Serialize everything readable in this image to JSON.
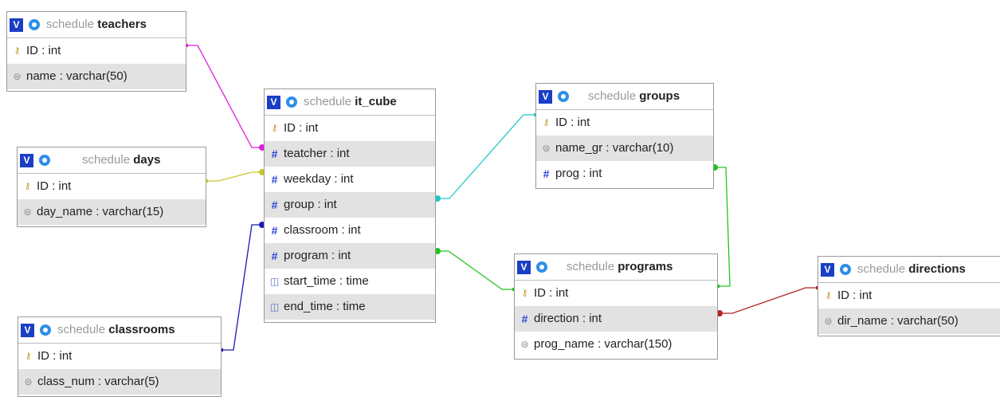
{
  "tables": {
    "teachers": {
      "schema": "schedule",
      "name": "teachers",
      "toggle": "V",
      "columns": [
        "ID : int",
        "name : varchar(50)"
      ]
    },
    "days": {
      "schema": "schedule",
      "name": "days",
      "toggle": "V",
      "columns": [
        "ID : int",
        "day_name : varchar(15)"
      ]
    },
    "classrooms": {
      "schema": "schedule",
      "name": "classrooms",
      "toggle": "V",
      "columns": [
        "ID : int",
        "class_num : varchar(5)"
      ]
    },
    "it_cube": {
      "schema": "schedule",
      "name": "it_cube",
      "toggle": "V",
      "columns": [
        "ID : int",
        "teatcher : int",
        "weekday : int",
        "group : int",
        "classroom : int",
        "program : int",
        "start_time : time",
        "end_time : time"
      ]
    },
    "groups": {
      "schema": "schedule",
      "name": "groups",
      "toggle": "V",
      "columns": [
        "ID : int",
        "name_gr : varchar(10)",
        "prog : int"
      ]
    },
    "programs": {
      "schema": "schedule",
      "name": "programs",
      "toggle": "V",
      "columns": [
        "ID : int",
        "direction : int",
        "prog_name : varchar(150)"
      ]
    },
    "directions": {
      "schema": "schedule",
      "name": "directions",
      "toggle": "V",
      "columns": [
        "ID : int",
        "dir_name : varchar(50)"
      ]
    }
  },
  "relations_colors": {
    "teatcher": "#e11be1",
    "weekday": "#c8c82a",
    "classroom": "#1a1ab5",
    "group": "#20c8c8",
    "program": "#22c322",
    "prog": "#22c322",
    "direction": "#b52323"
  },
  "colors": {
    "toggle_bg": "#1a3fc4",
    "gear": "#2e8ee8",
    "alt_row": "#e2e2e2",
    "key_icon": "#c49a2a",
    "hash_icon": "#2b3fd6"
  }
}
